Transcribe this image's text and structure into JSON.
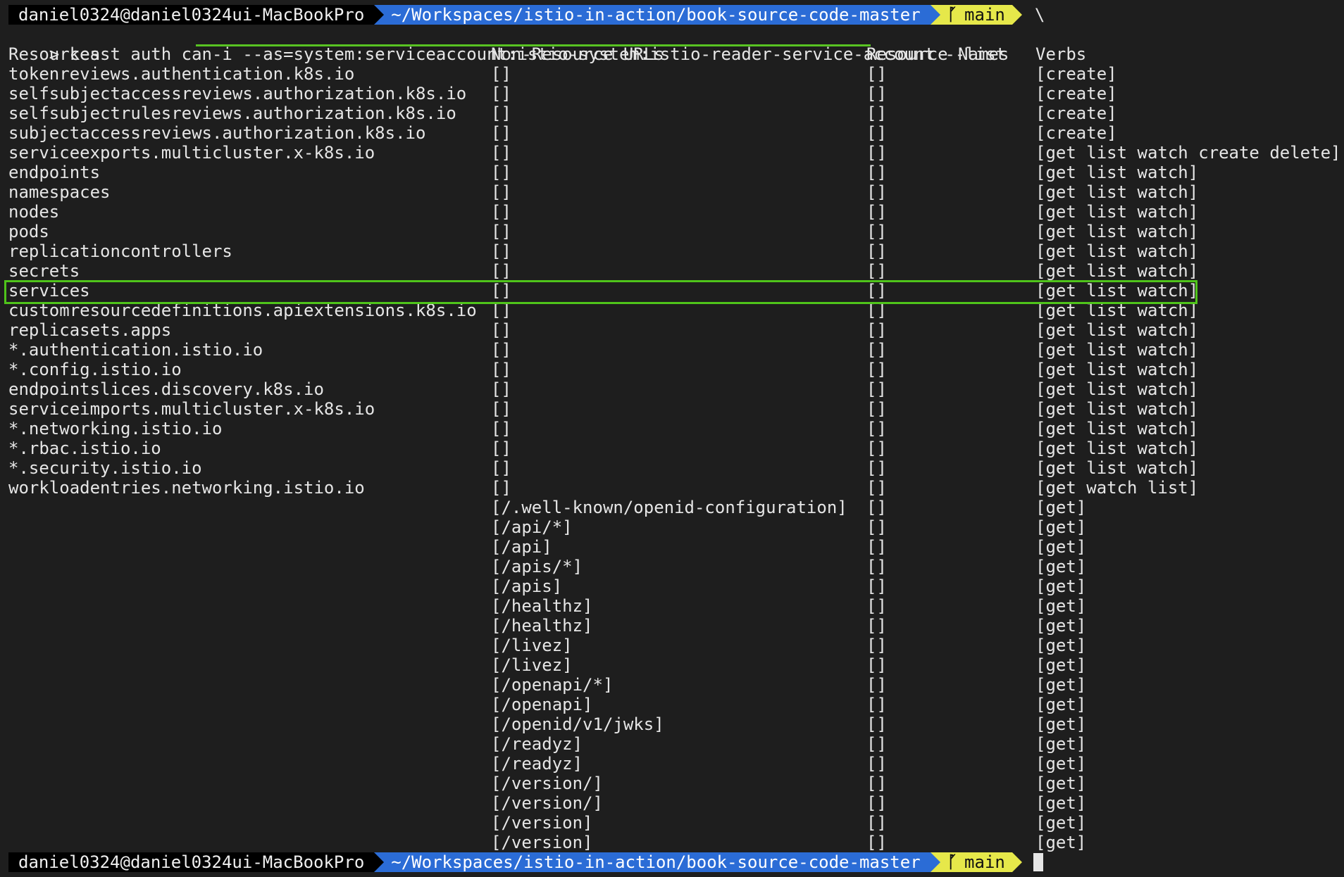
{
  "prompt": {
    "user_host": "daniel0324@daniel0324ui-MacBookPro",
    "path": "~/Workspaces/istio-in-action/book-source-code-master",
    "branch": "main",
    "branch_icon": "ᚵ",
    "tail": "\\"
  },
  "command": {
    "prefix": "> keast auth can-i ",
    "flag": "--as=system:serviceaccount:istio-system:istio-reader-service-account",
    "suffix": " --list"
  },
  "table": {
    "headers": [
      "Resources",
      "Non-Resource URLs",
      "Resource Names",
      "Verbs"
    ],
    "rows": [
      [
        "tokenreviews.authentication.k8s.io",
        "[]",
        "[]",
        "[create]"
      ],
      [
        "selfsubjectaccessreviews.authorization.k8s.io",
        "[]",
        "[]",
        "[create]"
      ],
      [
        "selfsubjectrulesreviews.authorization.k8s.io",
        "[]",
        "[]",
        "[create]"
      ],
      [
        "subjectaccessreviews.authorization.k8s.io",
        "[]",
        "[]",
        "[create]"
      ],
      [
        "serviceexports.multicluster.x-k8s.io",
        "[]",
        "[]",
        "[get list watch create delete]"
      ],
      [
        "endpoints",
        "[]",
        "[]",
        "[get list watch]"
      ],
      [
        "namespaces",
        "[]",
        "[]",
        "[get list watch]"
      ],
      [
        "nodes",
        "[]",
        "[]",
        "[get list watch]"
      ],
      [
        "pods",
        "[]",
        "[]",
        "[get list watch]"
      ],
      [
        "replicationcontrollers",
        "[]",
        "[]",
        "[get list watch]"
      ],
      [
        "secrets",
        "[]",
        "[]",
        "[get list watch]"
      ],
      [
        "services",
        "[]",
        "[]",
        "[get list watch]"
      ],
      [
        "customresourcedefinitions.apiextensions.k8s.io",
        "[]",
        "[]",
        "[get list watch]"
      ],
      [
        "replicasets.apps",
        "[]",
        "[]",
        "[get list watch]"
      ],
      [
        "*.authentication.istio.io",
        "[]",
        "[]",
        "[get list watch]"
      ],
      [
        "*.config.istio.io",
        "[]",
        "[]",
        "[get list watch]"
      ],
      [
        "endpointslices.discovery.k8s.io",
        "[]",
        "[]",
        "[get list watch]"
      ],
      [
        "serviceimports.multicluster.x-k8s.io",
        "[]",
        "[]",
        "[get list watch]"
      ],
      [
        "*.networking.istio.io",
        "[]",
        "[]",
        "[get list watch]"
      ],
      [
        "*.rbac.istio.io",
        "[]",
        "[]",
        "[get list watch]"
      ],
      [
        "*.security.istio.io",
        "[]",
        "[]",
        "[get list watch]"
      ],
      [
        "workloadentries.networking.istio.io",
        "[]",
        "[]",
        "[get watch list]"
      ],
      [
        "",
        "[/.well-known/openid-configuration]",
        "[]",
        "[get]"
      ],
      [
        "",
        "[/api/*]",
        "[]",
        "[get]"
      ],
      [
        "",
        "[/api]",
        "[]",
        "[get]"
      ],
      [
        "",
        "[/apis/*]",
        "[]",
        "[get]"
      ],
      [
        "",
        "[/apis]",
        "[]",
        "[get]"
      ],
      [
        "",
        "[/healthz]",
        "[]",
        "[get]"
      ],
      [
        "",
        "[/healthz]",
        "[]",
        "[get]"
      ],
      [
        "",
        "[/livez]",
        "[]",
        "[get]"
      ],
      [
        "",
        "[/livez]",
        "[]",
        "[get]"
      ],
      [
        "",
        "[/openapi/*]",
        "[]",
        "[get]"
      ],
      [
        "",
        "[/openapi]",
        "[]",
        "[get]"
      ],
      [
        "",
        "[/openid/v1/jwks]",
        "[]",
        "[get]"
      ],
      [
        "",
        "[/readyz]",
        "[]",
        "[get]"
      ],
      [
        "",
        "[/readyz]",
        "[]",
        "[get]"
      ],
      [
        "",
        "[/version/]",
        "[]",
        "[get]"
      ],
      [
        "",
        "[/version/]",
        "[]",
        "[get]"
      ],
      [
        "",
        "[/version]",
        "[]",
        "[get]"
      ],
      [
        "",
        "[/version]",
        "[]",
        "[get]"
      ]
    ],
    "highlighted_row": "services"
  },
  "colors": {
    "background": "#1e1e1e",
    "text": "#e6e6e6",
    "path_segment": "#2b6cd6",
    "branch_segment": "#e6e84a",
    "highlight": "#4fc41a"
  },
  "icons": {
    "branch": "git-branch-icon",
    "cursor": "terminal-cursor"
  }
}
